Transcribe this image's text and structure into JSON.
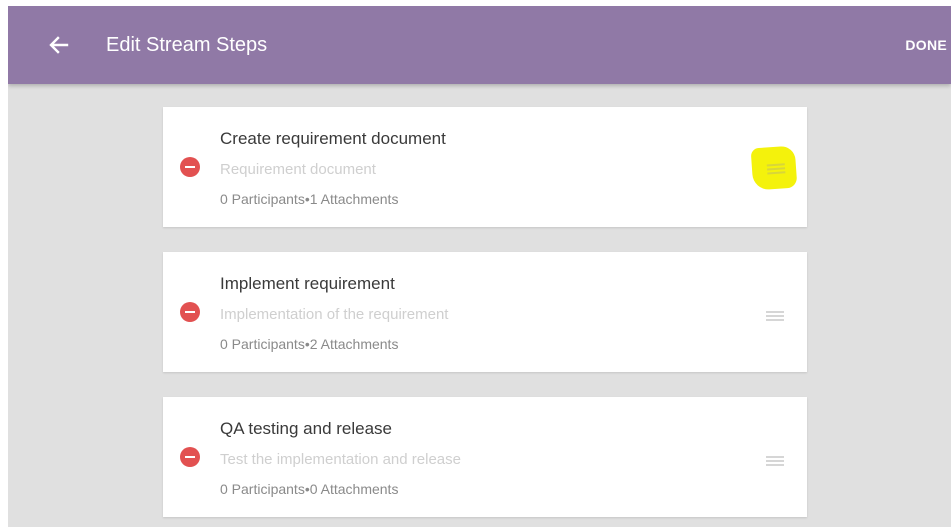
{
  "app_bar": {
    "title": "Edit Stream Steps",
    "done_label": "DONE",
    "back_icon": "arrow-left",
    "background_color": "#9079a6"
  },
  "steps": [
    {
      "title": "Create requirement document",
      "description": "Requirement document",
      "participants": "0 Participants",
      "separator": "•",
      "attachments": "1 Attachments",
      "drag_handle_highlighted": true
    },
    {
      "title": "Implement requirement",
      "description": "Implementation of the requirement",
      "participants": "0 Participants",
      "separator": "•",
      "attachments": "2 Attachments",
      "drag_handle_highlighted": false
    },
    {
      "title": "QA testing and release",
      "description": "Test the implementation and release",
      "participants": "0 Participants",
      "separator": "•",
      "attachments": "0 Attachments",
      "drag_handle_highlighted": false
    }
  ],
  "colors": {
    "remove_icon": "#e25151",
    "highlight": "#f4f20c",
    "background": "#e0e0e0"
  },
  "icons": {
    "remove": "remove-circle-icon",
    "drag": "drag-handle-icon"
  }
}
